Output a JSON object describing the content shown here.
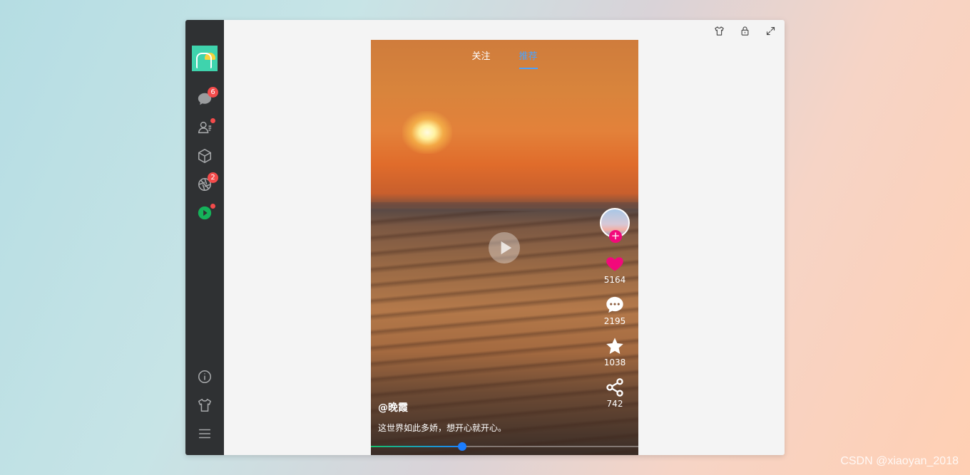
{
  "sidebar": {
    "items": [
      {
        "icon": "chat-icon",
        "badge": "6"
      },
      {
        "icon": "contacts-icon",
        "dot": true
      },
      {
        "icon": "cube-icon"
      },
      {
        "icon": "aperture-icon",
        "badge": "2"
      },
      {
        "icon": "play-circle-icon",
        "dot": true
      }
    ],
    "bottom_items": [
      {
        "icon": "info-icon"
      },
      {
        "icon": "shirt-icon"
      },
      {
        "icon": "menu-icon"
      }
    ]
  },
  "toolbar": {
    "icons": [
      "shirt-icon",
      "lock-icon",
      "fullscreen-icon"
    ]
  },
  "video": {
    "tabs": [
      {
        "label": "关注",
        "active": false
      },
      {
        "label": "推荐",
        "active": true
      }
    ],
    "actions": {
      "likes": "5164",
      "comments": "2195",
      "favorites": "1038",
      "shares": "742"
    },
    "username": "@晚霞",
    "description": "这世界如此多娇，想开心就开心。",
    "progress": 0.34,
    "colors": {
      "like": "#f2097b",
      "progress_start": "#16c06a",
      "progress_end": "#1c86ff",
      "tab_active": "#4aa3ff"
    }
  },
  "watermark": "CSDN @xiaoyan_2018"
}
